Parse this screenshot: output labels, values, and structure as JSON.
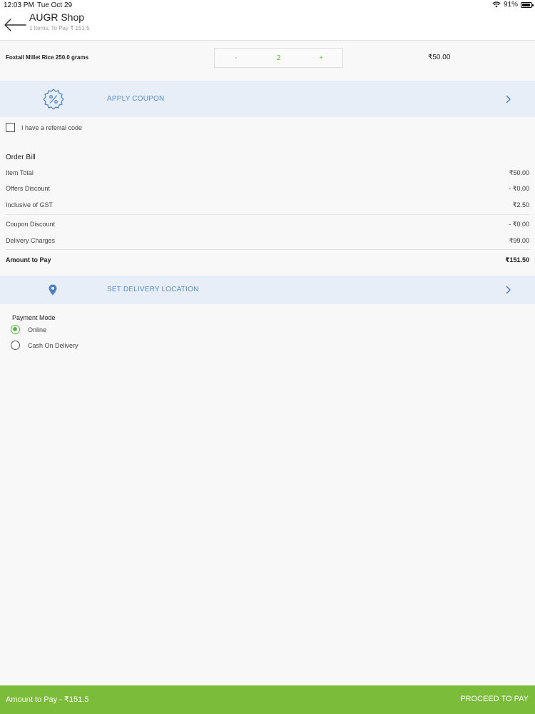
{
  "status_bar": {
    "time": "12:03 PM",
    "date": "Tue Oct 29",
    "battery": "91%",
    "battery_level": 0.91
  },
  "header": {
    "title": "AUGR Shop",
    "subtitle": "1 Items, To Pay ₹ 151.5",
    "back_icon": "arrow-left-icon"
  },
  "cart_item": {
    "name": "Foxtail Millet Rice 250.0 grams",
    "decrement_label": "-",
    "quantity": "2",
    "increment_label": "+",
    "price": "₹50.00"
  },
  "coupon": {
    "label": "APPLY COUPON",
    "icon": "percent-badge-icon"
  },
  "referral": {
    "label": "I have a referral code",
    "checked": false
  },
  "order_bill": {
    "title": "Order Bill",
    "rows": [
      {
        "label": "Item Total",
        "value": "₹50.00"
      },
      {
        "label": "Offers Discount",
        "value": "- ₹0.00"
      },
      {
        "label": "Inclusive of GST",
        "value": "₹2.50"
      },
      {
        "label": "Coupon Discount",
        "value": "- ₹0.00"
      },
      {
        "label": "Delivery Charges",
        "value": "₹99.00"
      }
    ],
    "total": {
      "label": "Amount to Pay",
      "value": "₹151.50"
    }
  },
  "delivery": {
    "label": "SET DELIVERY LOCATION",
    "icon": "map-pin-icon"
  },
  "payment": {
    "title": "Payment Mode",
    "options": [
      {
        "label": "Online",
        "selected": true
      },
      {
        "label": "Cash On Delivery",
        "selected": false
      }
    ]
  },
  "footer": {
    "amount_label": "Amount to Pay - ₹151.5",
    "proceed_label": "PROCEED TO PAY"
  },
  "colors": {
    "accent_green": "#7cbc3b",
    "link_blue": "#5a8fd0",
    "band_blue": "#e7eef8"
  }
}
